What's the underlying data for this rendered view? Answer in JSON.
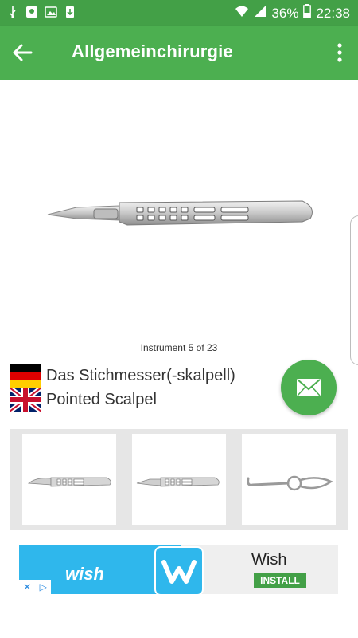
{
  "status_bar": {
    "battery": "36%",
    "time": "22:38"
  },
  "app_bar": {
    "title": "Allgemeinchirurgie"
  },
  "instrument": {
    "counter": "Instrument 5 of 23",
    "name_de": "Das Stichmesser(-skalpell)",
    "name_en": "Pointed Scalpel"
  },
  "ad": {
    "brand_wordmark": "wish",
    "name": "Wish",
    "install_label": "INSTALL"
  },
  "colors": {
    "primary": "#4caf50",
    "status_bar": "#43a047",
    "ad_blue": "#2fb7ec"
  }
}
